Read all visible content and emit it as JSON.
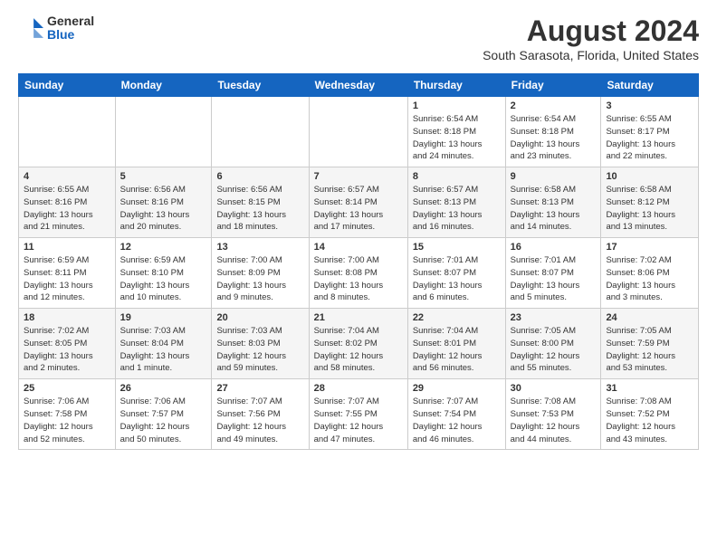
{
  "header": {
    "logo_general": "General",
    "logo_blue": "Blue",
    "title": "August 2024",
    "subtitle": "South Sarasota, Florida, United States"
  },
  "weekdays": [
    "Sunday",
    "Monday",
    "Tuesday",
    "Wednesday",
    "Thursday",
    "Friday",
    "Saturday"
  ],
  "weeks": [
    [
      {
        "day": "",
        "info": ""
      },
      {
        "day": "",
        "info": ""
      },
      {
        "day": "",
        "info": ""
      },
      {
        "day": "",
        "info": ""
      },
      {
        "day": "1",
        "info": "Sunrise: 6:54 AM\nSunset: 8:18 PM\nDaylight: 13 hours\nand 24 minutes."
      },
      {
        "day": "2",
        "info": "Sunrise: 6:54 AM\nSunset: 8:18 PM\nDaylight: 13 hours\nand 23 minutes."
      },
      {
        "day": "3",
        "info": "Sunrise: 6:55 AM\nSunset: 8:17 PM\nDaylight: 13 hours\nand 22 minutes."
      }
    ],
    [
      {
        "day": "4",
        "info": "Sunrise: 6:55 AM\nSunset: 8:16 PM\nDaylight: 13 hours\nand 21 minutes."
      },
      {
        "day": "5",
        "info": "Sunrise: 6:56 AM\nSunset: 8:16 PM\nDaylight: 13 hours\nand 20 minutes."
      },
      {
        "day": "6",
        "info": "Sunrise: 6:56 AM\nSunset: 8:15 PM\nDaylight: 13 hours\nand 18 minutes."
      },
      {
        "day": "7",
        "info": "Sunrise: 6:57 AM\nSunset: 8:14 PM\nDaylight: 13 hours\nand 17 minutes."
      },
      {
        "day": "8",
        "info": "Sunrise: 6:57 AM\nSunset: 8:13 PM\nDaylight: 13 hours\nand 16 minutes."
      },
      {
        "day": "9",
        "info": "Sunrise: 6:58 AM\nSunset: 8:13 PM\nDaylight: 13 hours\nand 14 minutes."
      },
      {
        "day": "10",
        "info": "Sunrise: 6:58 AM\nSunset: 8:12 PM\nDaylight: 13 hours\nand 13 minutes."
      }
    ],
    [
      {
        "day": "11",
        "info": "Sunrise: 6:59 AM\nSunset: 8:11 PM\nDaylight: 13 hours\nand 12 minutes."
      },
      {
        "day": "12",
        "info": "Sunrise: 6:59 AM\nSunset: 8:10 PM\nDaylight: 13 hours\nand 10 minutes."
      },
      {
        "day": "13",
        "info": "Sunrise: 7:00 AM\nSunset: 8:09 PM\nDaylight: 13 hours\nand 9 minutes."
      },
      {
        "day": "14",
        "info": "Sunrise: 7:00 AM\nSunset: 8:08 PM\nDaylight: 13 hours\nand 8 minutes."
      },
      {
        "day": "15",
        "info": "Sunrise: 7:01 AM\nSunset: 8:07 PM\nDaylight: 13 hours\nand 6 minutes."
      },
      {
        "day": "16",
        "info": "Sunrise: 7:01 AM\nSunset: 8:07 PM\nDaylight: 13 hours\nand 5 minutes."
      },
      {
        "day": "17",
        "info": "Sunrise: 7:02 AM\nSunset: 8:06 PM\nDaylight: 13 hours\nand 3 minutes."
      }
    ],
    [
      {
        "day": "18",
        "info": "Sunrise: 7:02 AM\nSunset: 8:05 PM\nDaylight: 13 hours\nand 2 minutes."
      },
      {
        "day": "19",
        "info": "Sunrise: 7:03 AM\nSunset: 8:04 PM\nDaylight: 13 hours\nand 1 minute."
      },
      {
        "day": "20",
        "info": "Sunrise: 7:03 AM\nSunset: 8:03 PM\nDaylight: 12 hours\nand 59 minutes."
      },
      {
        "day": "21",
        "info": "Sunrise: 7:04 AM\nSunset: 8:02 PM\nDaylight: 12 hours\nand 58 minutes."
      },
      {
        "day": "22",
        "info": "Sunrise: 7:04 AM\nSunset: 8:01 PM\nDaylight: 12 hours\nand 56 minutes."
      },
      {
        "day": "23",
        "info": "Sunrise: 7:05 AM\nSunset: 8:00 PM\nDaylight: 12 hours\nand 55 minutes."
      },
      {
        "day": "24",
        "info": "Sunrise: 7:05 AM\nSunset: 7:59 PM\nDaylight: 12 hours\nand 53 minutes."
      }
    ],
    [
      {
        "day": "25",
        "info": "Sunrise: 7:06 AM\nSunset: 7:58 PM\nDaylight: 12 hours\nand 52 minutes."
      },
      {
        "day": "26",
        "info": "Sunrise: 7:06 AM\nSunset: 7:57 PM\nDaylight: 12 hours\nand 50 minutes."
      },
      {
        "day": "27",
        "info": "Sunrise: 7:07 AM\nSunset: 7:56 PM\nDaylight: 12 hours\nand 49 minutes."
      },
      {
        "day": "28",
        "info": "Sunrise: 7:07 AM\nSunset: 7:55 PM\nDaylight: 12 hours\nand 47 minutes."
      },
      {
        "day": "29",
        "info": "Sunrise: 7:07 AM\nSunset: 7:54 PM\nDaylight: 12 hours\nand 46 minutes."
      },
      {
        "day": "30",
        "info": "Sunrise: 7:08 AM\nSunset: 7:53 PM\nDaylight: 12 hours\nand 44 minutes."
      },
      {
        "day": "31",
        "info": "Sunrise: 7:08 AM\nSunset: 7:52 PM\nDaylight: 12 hours\nand 43 minutes."
      }
    ]
  ]
}
